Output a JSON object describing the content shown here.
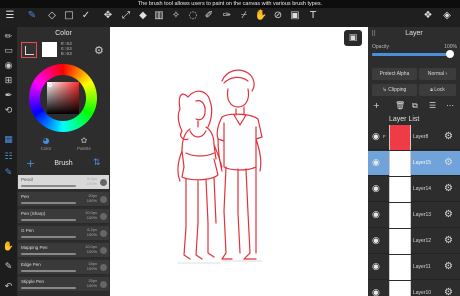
{
  "caption": "The brush tool allows users to paint on the canvas with various brush types.",
  "color_panel": {
    "title": "Color",
    "rgb_lines": [
      "R:63",
      "G:63",
      "B:63"
    ],
    "tabs": [
      {
        "label": "Color",
        "icon": "palette-icon"
      },
      {
        "label": "Palette",
        "icon": "swatches-icon"
      }
    ]
  },
  "brush_panel": {
    "title": "Brush",
    "brushes": [
      {
        "name": "Pencil",
        "size": "8.0px\n100%"
      },
      {
        "name": "Pen",
        "size": "20px\n100%"
      },
      {
        "name": "Pen (Sharp)",
        "size": "10.0px\n100%"
      },
      {
        "name": "G Pen",
        "size": "6.2px\n100%"
      },
      {
        "name": "Mapping Pen",
        "size": "10.0px\n100%"
      },
      {
        "name": "Edge Pen",
        "size": "15px\n100%"
      },
      {
        "name": "Stipple Pen",
        "size": "25px\n100%"
      }
    ],
    "selected_index": 0
  },
  "layer_panel": {
    "title": "Layer",
    "opacity_label": "Opacity",
    "opacity_value": "100%",
    "opacity_fraction": 1.0,
    "protect_alpha": "Protect Alpha",
    "blend_mode": "Normal",
    "clipping": "Clipping",
    "lock": "Lock",
    "list_title": "Layer List",
    "layers": [
      {
        "name": "Layer8",
        "flag": "F",
        "thumb": "red"
      },
      {
        "name": "Layer15",
        "flag": "",
        "thumb": "white"
      },
      {
        "name": "Layer14",
        "flag": "",
        "thumb": "white"
      },
      {
        "name": "Layer13",
        "flag": "",
        "thumb": "white"
      },
      {
        "name": "Layer12",
        "flag": "",
        "thumb": "white"
      },
      {
        "name": "Layer11",
        "flag": "",
        "thumb": "white"
      },
      {
        "name": "Layer10",
        "flag": "",
        "thumb": "white"
      }
    ],
    "selected_layer": 1
  },
  "colors": {
    "accent": "#4a8ede",
    "sketch": "#e2323c",
    "selected_layer": "#6fa3da"
  }
}
